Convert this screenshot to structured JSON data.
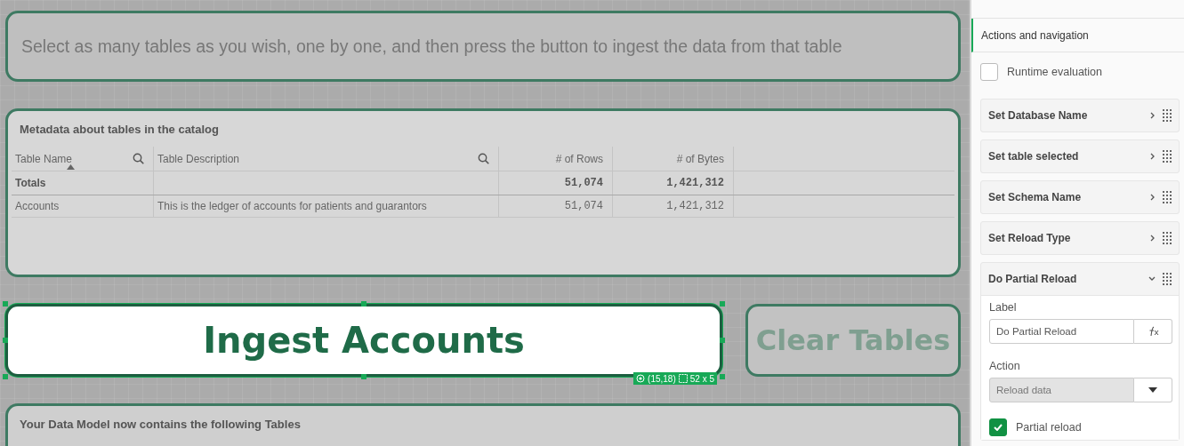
{
  "instruction_card": {
    "text": "Select as many tables as you wish, one by one, and then press the button to ingest the data from that table"
  },
  "metadata_table": {
    "title": "Metadata about tables in the catalog",
    "columns": [
      {
        "label": "Table Name",
        "searchable": true,
        "sorted": true,
        "kind": "text"
      },
      {
        "label": "Table Description",
        "searchable": true,
        "sorted": false,
        "kind": "text"
      },
      {
        "label": "# of Rows",
        "searchable": false,
        "sorted": false,
        "kind": "number"
      },
      {
        "label": "# of Bytes",
        "searchable": false,
        "sorted": false,
        "kind": "number"
      }
    ],
    "totals": {
      "label": "Totals",
      "row_count": "51,074",
      "byte_count": "1,421,312"
    },
    "rows": [
      [
        "Accounts",
        "This is the ledger of accounts for patients and guarantors",
        "51,074",
        "1,421,312"
      ]
    ]
  },
  "ingest_button": {
    "label": "Ingest Accounts",
    "selected": true
  },
  "selection_badge": {
    "position": "(15,18)",
    "size": "52 x 5"
  },
  "clear_button": {
    "label": "Clear Tables",
    "selected": false
  },
  "data_model_card": {
    "title": "Your Data Model now contains the following Tables"
  },
  "panel": {
    "header": "Actions and navigation",
    "runtime_evaluation": {
      "label": "Runtime evaluation",
      "checked": false
    },
    "actions": [
      {
        "label": "Set Database Name",
        "expanded": false
      },
      {
        "label": "Set table selected",
        "expanded": false
      },
      {
        "label": "Set Schema Name",
        "expanded": false
      },
      {
        "label": "Set Reload Type",
        "expanded": false
      },
      {
        "label": "Do Partial Reload",
        "expanded": true,
        "label_field": {
          "label": "Label",
          "value": "Do Partial Reload"
        },
        "action_field": {
          "label": "Action",
          "value": "Reload data"
        },
        "partial_reload": {
          "label": "Partial reload",
          "checked": true
        }
      }
    ]
  }
}
